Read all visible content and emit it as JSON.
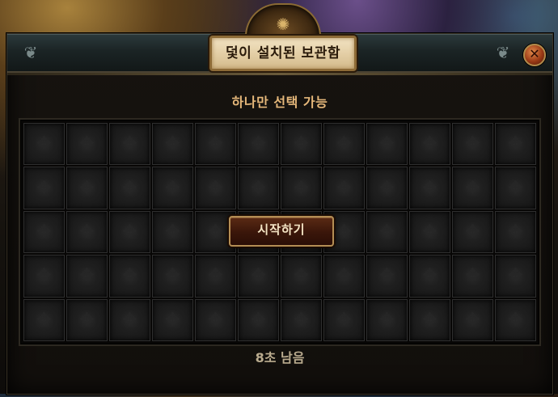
{
  "window": {
    "title": "덫이 설치된 보관함",
    "subtitle": "하나만 선택 가능",
    "timer_text": "8초 남음",
    "close_icon": "close-icon"
  },
  "grid": {
    "rows": 5,
    "columns": 12,
    "slot_icon": "rune-symbol-icon"
  },
  "actions": {
    "start_label": "시작하기"
  },
  "colors": {
    "subtitle": "#e6b87a",
    "title_plate": "#e4cfa6",
    "button_bg": "#3a160a",
    "button_border": "#b48e54",
    "timer": "#b9ab8e"
  }
}
